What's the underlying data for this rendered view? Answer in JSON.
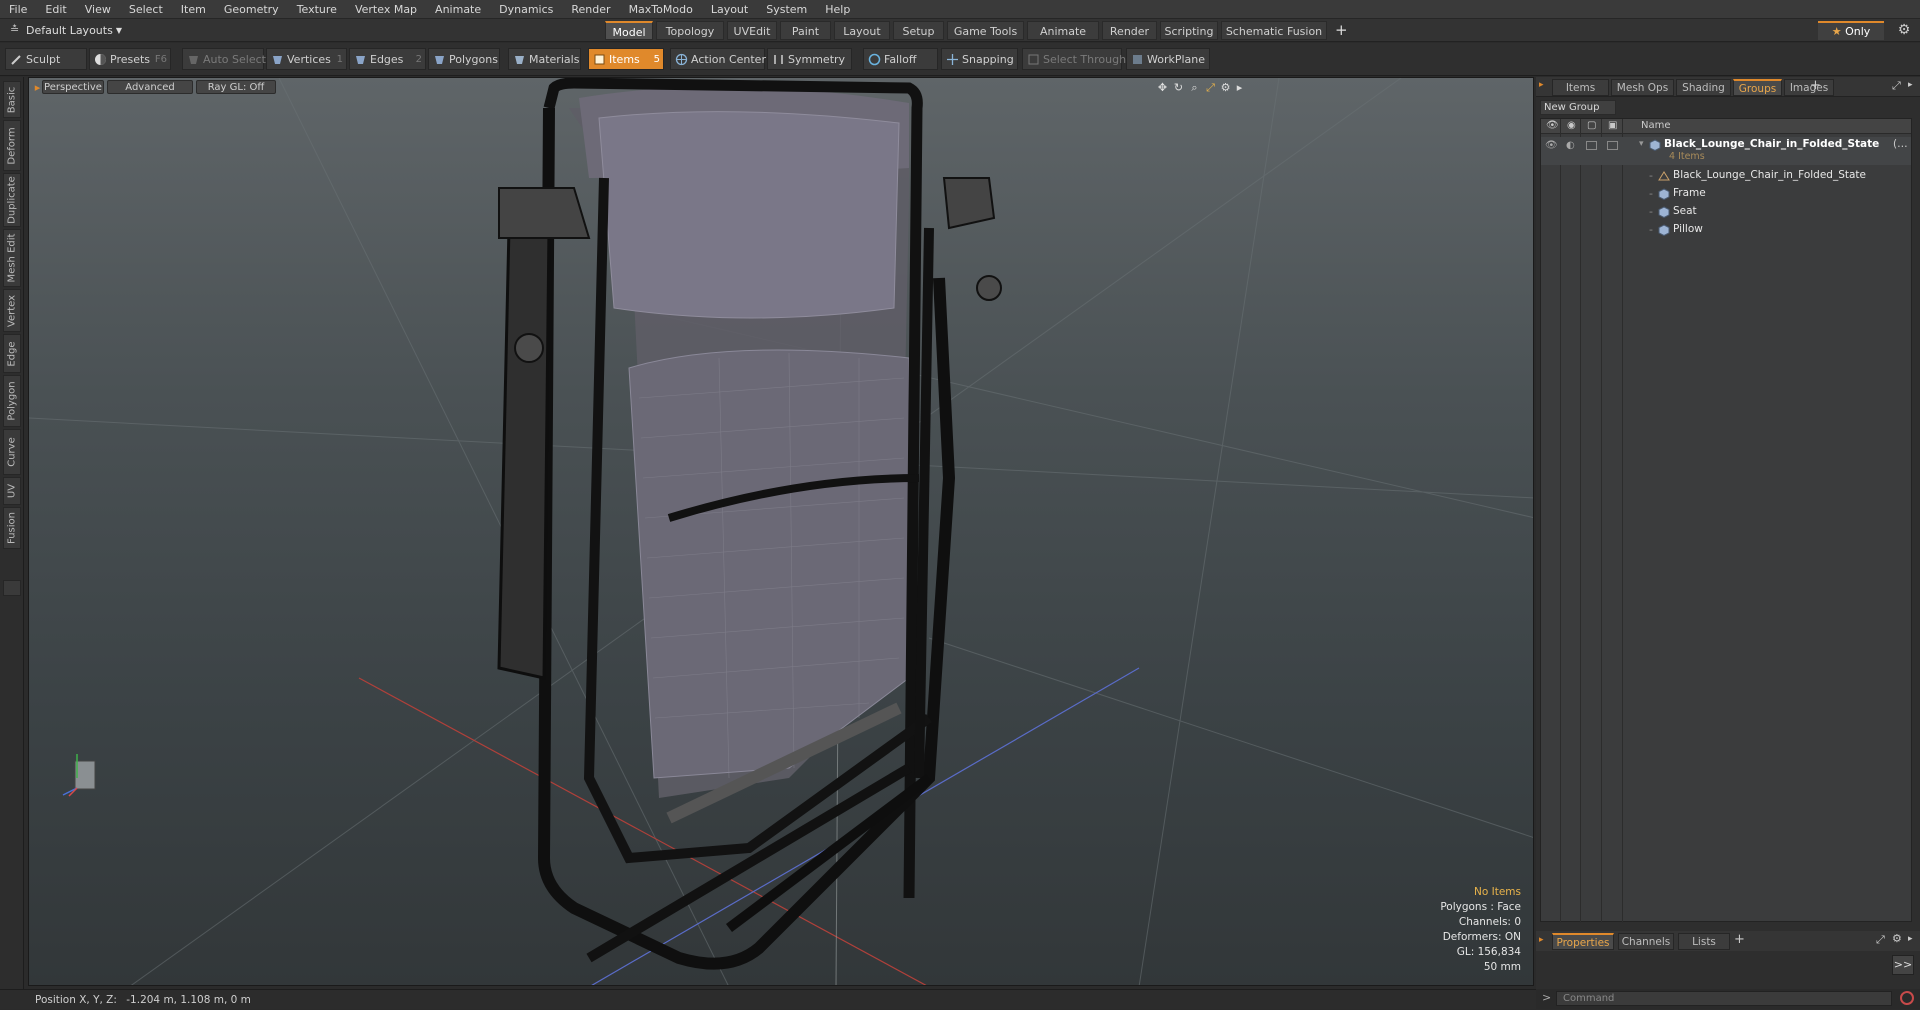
{
  "menu": [
    "File",
    "Edit",
    "View",
    "Select",
    "Item",
    "Geometry",
    "Texture",
    "Vertex Map",
    "Animate",
    "Dynamics",
    "Render",
    "MaxToModo",
    "Layout",
    "System",
    "Help"
  ],
  "layout_bar": {
    "layout_select": "Default Layouts",
    "tabs": [
      "Model",
      "Topology",
      "UVEdit",
      "Paint",
      "Layout",
      "Setup",
      "Game Tools",
      "Animate",
      "Render",
      "Scripting",
      "Schematic Fusion"
    ],
    "active_tab": "Model",
    "only_label": "Only"
  },
  "toolbar": {
    "sculpt": "Sculpt",
    "presets": "Presets",
    "presets_key": "F6",
    "auto_select": "Auto Select",
    "vertices": "Vertices",
    "vertices_key": "1",
    "edges": "Edges",
    "edges_key": "2",
    "polygons": "Polygons",
    "materials": "Materials",
    "items": "Items",
    "items_key": "5",
    "action_center": "Action Center",
    "symmetry": "Symmetry",
    "falloff": "Falloff",
    "snapping": "Snapping",
    "select_through": "Select Through",
    "workplane": "WorkPlane"
  },
  "left_tabs": [
    "Basic",
    "Deform",
    "Duplicate",
    "Mesh Edit",
    "Vertex",
    "Edge",
    "Polygon",
    "Curve",
    "UV",
    "Fusion"
  ],
  "viewport": {
    "view_mode": "Perspective",
    "shading": "Advanced",
    "raygl": "Ray GL: Off",
    "info": {
      "title": "No Items",
      "polygons": "Polygons : Face",
      "channels": "Channels: 0",
      "deformers": "Deformers: ON",
      "gl": "GL: 156,834",
      "size": "50 mm"
    }
  },
  "right_panel": {
    "tabs": [
      "Items",
      "Mesh Ops",
      "Shading",
      "Groups",
      "Images"
    ],
    "active_tab": "Groups",
    "new_group": "New Group",
    "name_header": "Name",
    "group": {
      "name": "Black_Lounge_Chair_in_Folded_State",
      "suffix": "(…",
      "count": "4 Items",
      "children": [
        "Black_Lounge_Chair_in_Folded_State",
        "Frame",
        "Seat",
        "Pillow"
      ]
    },
    "bottom_tabs": [
      "Properties",
      "Channels",
      "Lists"
    ],
    "bottom_active": "Properties",
    "expand_label": ">>",
    "command_placeholder": "Command"
  },
  "status": {
    "position_label": "Position X, Y, Z:",
    "position_value": "-1.204 m, 1.108 m, 0 m"
  },
  "colors": {
    "accent": "#e0892b",
    "info_title": "#e9b34b"
  }
}
